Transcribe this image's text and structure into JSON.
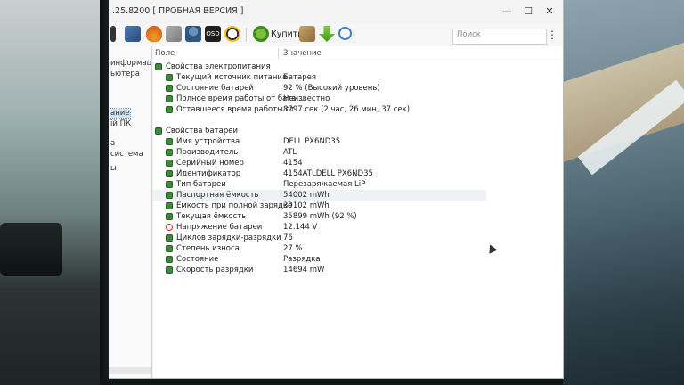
{
  "window": {
    "title": ".25.8200  [ ПРОБНАЯ ВЕРСИЯ ]",
    "controls": {
      "minimize": "—",
      "maximize": "☐",
      "close": "✕"
    }
  },
  "toolbar": {
    "buy_label": "Купить",
    "search_placeholder": "Поиск",
    "menu_glyph": "⋮",
    "icons": [
      "chip-icon",
      "flame-icon",
      "tools-icon",
      "user-icon",
      "osd-icon",
      "gauge-icon",
      "buy-icon",
      "wrench-icon",
      "download-icon",
      "search-icon"
    ]
  },
  "nav": {
    "items": [
      "информац",
      "ьютера",
      "",
      "ание",
      "ій ПК",
      "а",
      "система",
      "",
      "ы"
    ]
  },
  "table": {
    "col_field": "Поле",
    "col_value": "Значение",
    "sections": [
      {
        "title": "Свойства электропитания",
        "rows": [
          {
            "field": "Текущий источник питания",
            "value": "Батарея"
          },
          {
            "field": "Состояние батарей",
            "value": "92 % (Высокий уровень)"
          },
          {
            "field": "Полное время работы от бата...",
            "value": "Неизвестно"
          },
          {
            "field": "Оставшееся время работы от ...",
            "value": "8797 сек (2 час, 26 мин, 37 сек)"
          }
        ]
      },
      {
        "title": "Свойства батареи",
        "rows": [
          {
            "field": "Имя устройства",
            "value": "DELL PX6ND35"
          },
          {
            "field": "Производитель",
            "value": "ATL"
          },
          {
            "field": "Серийный номер",
            "value": "4154"
          },
          {
            "field": "Идентификатор",
            "value": "4154ATLDELL PX6ND35"
          },
          {
            "field": "Тип батареи",
            "value": "Перезаряжаемая LiP"
          },
          {
            "field": "Паспортная ёмкость",
            "value": "54002 mWh"
          },
          {
            "field": "Ёмкость при полной зарядке",
            "value": "39102 mWh"
          },
          {
            "field": "Текущая ёмкость",
            "value": "35899 mWh  (92 %)"
          },
          {
            "field": "Напряжение батареи",
            "value": "12.144 V"
          },
          {
            "field": "Циклов зарядки-разрядки",
            "value": "76"
          },
          {
            "field": "Степень износа",
            "value": "27 %"
          },
          {
            "field": "Состояние",
            "value": "Разрядка"
          },
          {
            "field": "Скорость разрядки",
            "value": "14694 mW"
          }
        ]
      }
    ]
  }
}
